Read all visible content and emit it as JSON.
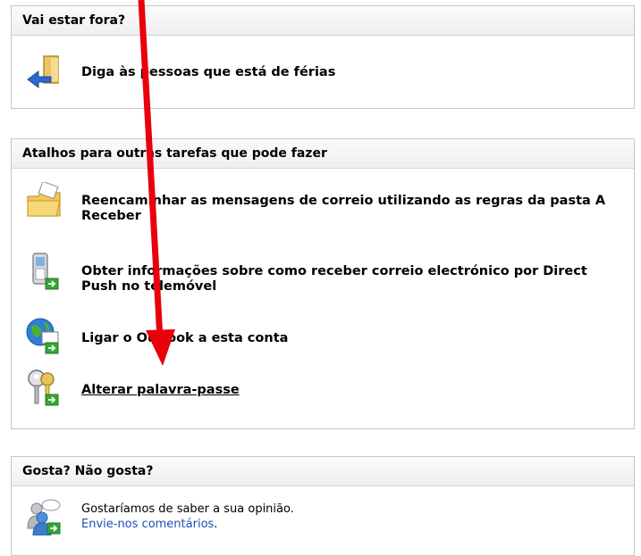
{
  "away": {
    "header": "Vai estar fora?",
    "items": [
      {
        "label": "Diga às pessoas que está de férias"
      }
    ]
  },
  "shortcuts": {
    "header": "Atalhos para outras tarefas que pode fazer",
    "items": [
      {
        "label": "Reencaminhar as mensagens de correio utilizando as regras da pasta A Receber"
      },
      {
        "label": "Obter informações sobre como receber correio electrónico por Direct Push no telemóvel"
      },
      {
        "label": "Ligar o Outlook a esta conta"
      },
      {
        "label": "Alterar palavra-passe"
      }
    ]
  },
  "feedback": {
    "header": "Gosta? Não gosta?",
    "line1": "Gostaríamos de saber a sua opinião.",
    "link_text": "Envie-nos comentários",
    "after_link": "."
  },
  "colors": {
    "annotation_arrow": "#e8000b",
    "link_blue": "#1a4fb8",
    "panel_border": "#c6c6c6"
  },
  "icons": [
    "door-arrow-icon",
    "folder-letter-icon",
    "phone-arrow-icon",
    "globe-mail-icon",
    "keys-arrow-icon",
    "people-chat-icon"
  ]
}
